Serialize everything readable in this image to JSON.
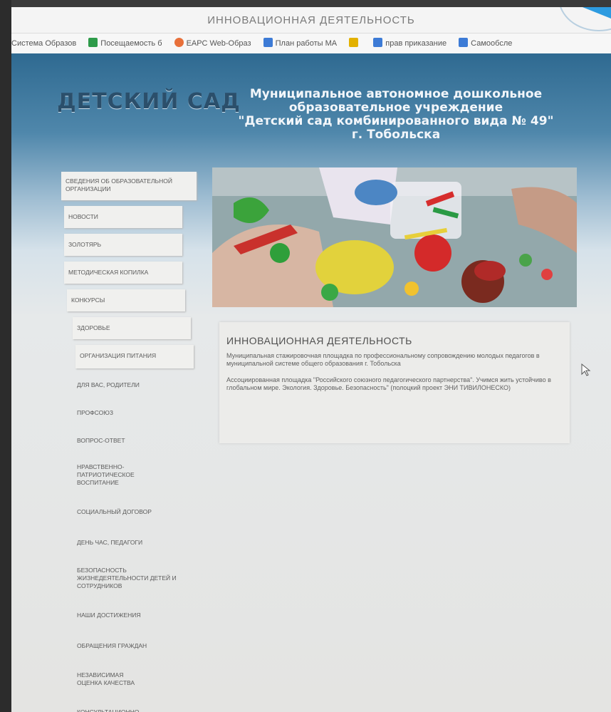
{
  "browser": {
    "title": "ИННОВАЦИОННАЯ ДЕЯТЕЛЬНОСТЬ",
    "bookmarks": [
      {
        "label": "Система Образов",
        "icon": "none"
      },
      {
        "label": "Посещаемость б",
        "icon": "green-square-icon"
      },
      {
        "label": "ЕАРС Web-Образ",
        "icon": "orange-logo-icon"
      },
      {
        "label": "План работы МА",
        "icon": "blue-doc-icon"
      },
      {
        "label": "",
        "icon": "yellow-u-icon"
      },
      {
        "label": "прав приказание",
        "icon": "blue-doc-icon"
      },
      {
        "label": "Самообсле",
        "icon": "blue-doc-icon"
      }
    ]
  },
  "site": {
    "logo": "ДЕТСКИЙ САД",
    "org_line1": "Муниципальное автономное дошкольное",
    "org_line2": "образовательное учреждение",
    "org_line3": "\"Детский сад комбинированного вида № 49\"",
    "org_line4": "г. Тобольска"
  },
  "menu": [
    "СВЕДЕНИЯ ОБ ОБРАЗОВАТЕЛЬНОЙ ОРГАНИЗАЦИИ",
    "НОВОСТИ",
    "ЗОЛОТЯРЬ",
    "МЕТОДИЧЕСКАЯ КОПИЛКА",
    "КОНКУРСЫ",
    "ЗДОРОВЬЕ",
    "ОРГАНИЗАЦИЯ ПИТАНИЯ",
    "ДЛЯ ВАС, РОДИТЕЛИ",
    "ПРОФСОЮЗ",
    "ВОПРОС-ОТВЕТ",
    "НРАВСТВЕННО-ПАТРИОТИЧЕСКОЕ ВОСПИТАНИЕ",
    "СОЦИАЛЬНЫЙ ДОГОВОР",
    "ДЕНЬ ЧАС, ПЕДАГОГИ",
    "БЕЗОПАСНОСТЬ ЖИЗНЕДЕЯТЕЛЬНОСТИ ДЕТЕЙ И СОТРУДНИКОВ",
    "НАШИ ДОСТИЖЕНИЯ",
    "ОБРАЩЕНИЯ ГРАЖДАН",
    "НЕЗАВИСИМАЯ ОЦЕНКА КАЧЕСТВА",
    "КОНСУЛЬТАЦИОННО-МЕТОДИЧЕСКИЙ ПУНКТ"
  ],
  "content": {
    "title": "ИННОВАЦИОННАЯ ДЕЯТЕЛЬНОСТЬ",
    "paragraph1": "Муниципальная стажировочная площадка по профессиональному сопровождению молодых педагогов в муниципальной системе общего образования г. Тобольска",
    "paragraph2": "Ассоциированная площадка \"Российского союзного педагогического партнерства\". Учимся жить устойчиво в глобальном мире. Экология. Здоровье. Безопасность\" (полоцкий проект ЭНИ ТИВИЛОНЕСКО)"
  },
  "colors": {
    "header_blue": "#2f6a91",
    "logo_text": "#2b4f6b",
    "browser_accent": "#2d9be0"
  }
}
